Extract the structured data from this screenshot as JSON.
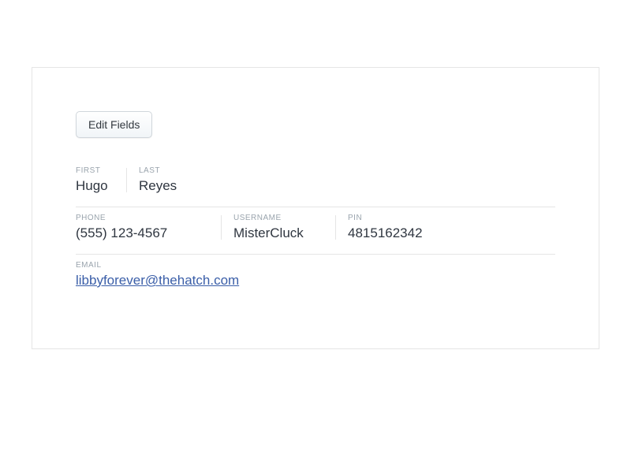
{
  "toolbar": {
    "edit_label": "Edit Fields"
  },
  "fields": {
    "first": {
      "label": "First",
      "value": "Hugo"
    },
    "last": {
      "label": "Last",
      "value": "Reyes"
    },
    "phone": {
      "label": "Phone",
      "value": "(555) 123-4567"
    },
    "username": {
      "label": "Username",
      "value": "MisterCluck"
    },
    "pin": {
      "label": "PIN",
      "value": "4815162342"
    },
    "email": {
      "label": "Email",
      "value": "libbyforever@thehatch.com"
    }
  }
}
